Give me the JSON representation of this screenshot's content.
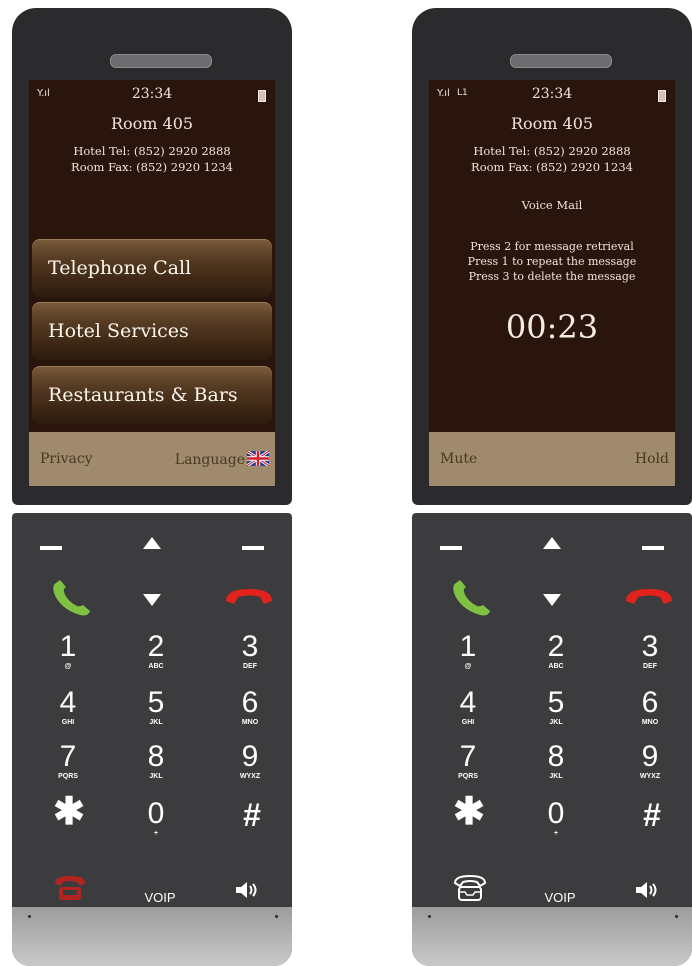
{
  "left_phone": {
    "status": {
      "time": "23:34"
    },
    "room": "Room 405",
    "hotel_tel": "Hotel Tel:  (852) 2920 2888",
    "room_fax": "Room Fax: (852) 2920 1234",
    "menu": [
      {
        "label": "Telephone Call"
      },
      {
        "label": "Hotel Services"
      },
      {
        "label": "Restaurants & Bars"
      }
    ],
    "softkeys": {
      "left": "Privacy",
      "right": "Language"
    }
  },
  "right_phone": {
    "status": {
      "time": "23:34",
      "line_indicator": "L1"
    },
    "room": "Room 405",
    "hotel_tel": "Hotel Tel:  (852) 2920 2888",
    "room_fax": "Room Fax: (852) 2920 1234",
    "screen_title": "Voice Mail",
    "instructions": [
      "Press 2 for message retrieval",
      "Press 1 to repeat the message",
      "Press 3 to delete the message"
    ],
    "timer": "00:23",
    "softkeys": {
      "left": "Mute",
      "right": "Hold"
    }
  },
  "keypad": {
    "keys": [
      {
        "digit": "1",
        "sub": "@"
      },
      {
        "digit": "2",
        "sub": "ABC"
      },
      {
        "digit": "3",
        "sub": "DEF"
      },
      {
        "digit": "4",
        "sub": "GHI"
      },
      {
        "digit": "5",
        "sub": "JKL"
      },
      {
        "digit": "6",
        "sub": "MNO"
      },
      {
        "digit": "7",
        "sub": "PQRS"
      },
      {
        "digit": "8",
        "sub": "JKL"
      },
      {
        "digit": "9",
        "sub": "WYXZ"
      },
      {
        "digit": "0",
        "sub": "+"
      }
    ],
    "star": "✱",
    "hash": "#",
    "voip_label": "VOIP"
  },
  "colors": {
    "screen_bg": "#2a150c",
    "softbar_bg": "#a08a6e",
    "call_green": "#7fc241",
    "end_red": "#e0231d",
    "body_dark": "#3c3c3e"
  },
  "icons": {
    "call": "phone-handset-green",
    "end": "phone-handset-red",
    "voicemail_left": "voicemail-red",
    "voicemail_right": "inbox-tray-outline",
    "speaker": "speaker-volume",
    "flag": "uk-flag"
  }
}
